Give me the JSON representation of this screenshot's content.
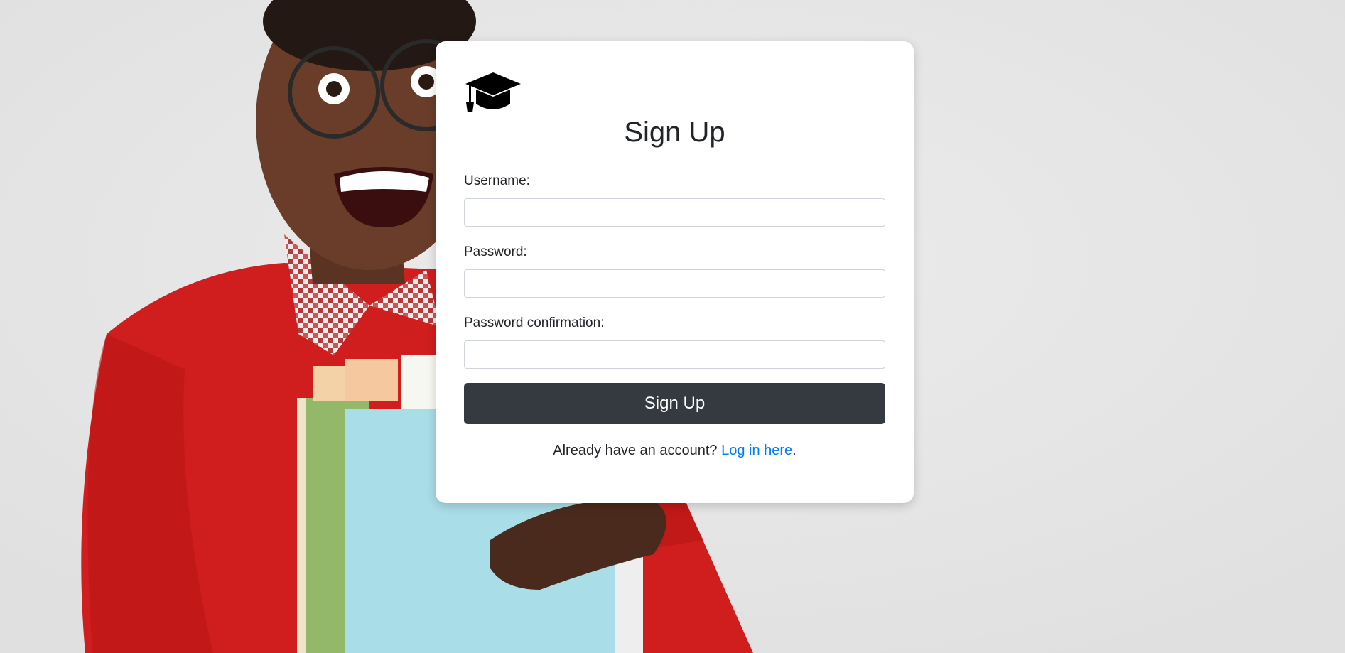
{
  "form": {
    "title": "Sign Up",
    "logo_icon": "graduation-cap-icon",
    "fields": [
      {
        "label": "Username:",
        "value": "",
        "placeholder": ""
      },
      {
        "label": "Password:",
        "value": "",
        "placeholder": ""
      },
      {
        "label": "Password confirmation:",
        "value": "",
        "placeholder": ""
      }
    ],
    "submit_label": "Sign Up",
    "footer_text": "Already have an account? ",
    "login_link": "Log in here",
    "footer_suffix": "."
  },
  "colors": {
    "background": "#e5e5e5",
    "card": "#ffffff",
    "button": "#343a40",
    "link": "#007bff",
    "sweater": "#d01e1e"
  }
}
